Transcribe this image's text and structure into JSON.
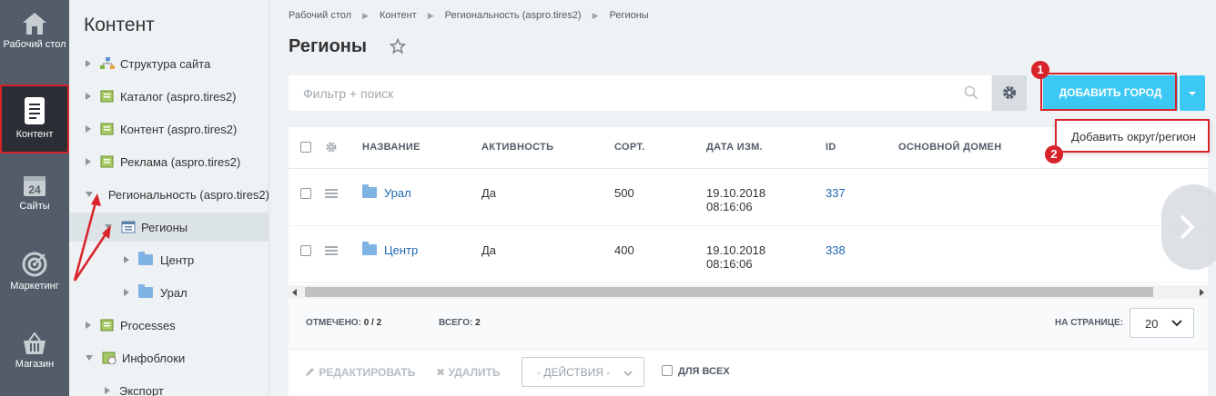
{
  "nav": [
    {
      "label": "Рабочий стол",
      "icon": "home-icon"
    },
    {
      "label": "Контент",
      "icon": "document-icon"
    },
    {
      "label": "Сайты",
      "icon": "calendar-icon",
      "num": "24"
    },
    {
      "label": "Маркетинг",
      "icon": "target-icon"
    },
    {
      "label": "Магазин",
      "icon": "basket-icon"
    }
  ],
  "tree": {
    "title": "Контент",
    "items": [
      {
        "label": "Структура сайта"
      },
      {
        "label": "Каталог (aspro.tires2)"
      },
      {
        "label": "Контент (aspro.tires2)"
      },
      {
        "label": "Реклама (aspro.tires2)"
      },
      {
        "label": "Региональность (aspro.tires2)"
      },
      {
        "label": "Регионы"
      },
      {
        "label": "Центр"
      },
      {
        "label": "Урал"
      },
      {
        "label": "Processes"
      },
      {
        "label": "Инфоблоки"
      },
      {
        "label": "Экспорт"
      }
    ]
  },
  "breadcrumbs": [
    "Рабочий стол",
    "Контент",
    "Региональность (aspro.tires2)",
    "Регионы"
  ],
  "page": {
    "title": "Регионы",
    "filter_placeholder": "Фильтр + поиск",
    "add_label": "ДОБАВИТЬ ГОРОД",
    "dropdown_item": "Добавить округ/регион",
    "badge1": "1",
    "badge2": "2"
  },
  "grid": {
    "columns": [
      "НАЗВАНИЕ",
      "АКТИВНОСТЬ",
      "СОРТ.",
      "ДАТА ИЗМ.",
      "ID",
      "ОСНОВНОЙ ДОМЕН"
    ],
    "rows": [
      {
        "name": "Урал",
        "active": "Да",
        "sort": "500",
        "date": "19.10.2018",
        "time": "08:16:06",
        "id": "337"
      },
      {
        "name": "Центр",
        "active": "Да",
        "sort": "400",
        "date": "19.10.2018",
        "time": "08:16:06",
        "id": "338"
      }
    ],
    "footer": {
      "selected_label": "ОТМЕЧЕНО:",
      "selected_value": "0 / 2",
      "total_label": "ВСЕГО:",
      "total_value": "2",
      "per_page_label": "НА СТРАНИЦЕ:",
      "per_page_value": "20"
    },
    "actions": {
      "edit": "РЕДАКТИРОВАТЬ",
      "delete": "УДАЛИТЬ",
      "select": "- ДЕЙСТВИЯ -",
      "for_all": "ДЛЯ ВСЕХ"
    }
  }
}
